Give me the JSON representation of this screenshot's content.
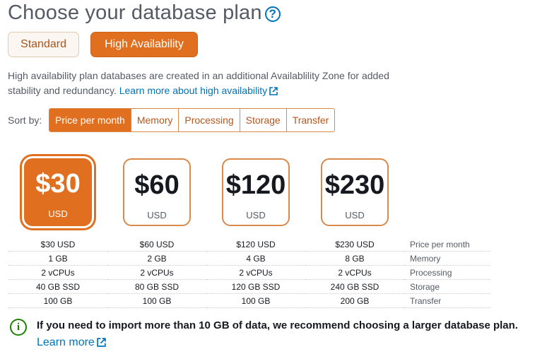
{
  "header": {
    "title": "Choose your database plan",
    "help_icon_glyph": "?"
  },
  "plan_types": {
    "standard_label": "Standard",
    "high_availability_label": "High Availability",
    "selected": "High Availability"
  },
  "description": {
    "text": "High availability plan databases are created in an additional Availablility Zone for added stability and redundancy.",
    "link_text": "Learn more about high availability"
  },
  "sort": {
    "label": "Sort by:",
    "options": [
      "Price per month",
      "Memory",
      "Processing",
      "Storage",
      "Transfer"
    ],
    "active": "Price per month"
  },
  "plans": [
    {
      "price": "$30",
      "currency": "USD",
      "selected": true,
      "price_per_month": "$30 USD",
      "memory": "1 GB",
      "processing": "2 vCPUs",
      "storage": "40 GB SSD",
      "transfer": "100 GB"
    },
    {
      "price": "$60",
      "currency": "USD",
      "selected": false,
      "price_per_month": "$60 USD",
      "memory": "2 GB",
      "processing": "2 vCPUs",
      "storage": "80 GB SSD",
      "transfer": "100 GB"
    },
    {
      "price": "$120",
      "currency": "USD",
      "selected": false,
      "price_per_month": "$120 USD",
      "memory": "4 GB",
      "processing": "2 vCPUs",
      "storage": "120 GB SSD",
      "transfer": "100 GB"
    },
    {
      "price": "$230",
      "currency": "USD",
      "selected": false,
      "price_per_month": "$230 USD",
      "memory": "8 GB",
      "processing": "2 vCPUs",
      "storage": "240 GB SSD",
      "transfer": "200 GB"
    }
  ],
  "row_labels": [
    "Price per month",
    "Memory",
    "Processing",
    "Storage",
    "Transfer"
  ],
  "notice": {
    "icon": "info-icon",
    "text": "If you need to import more than 10 GB of data, we recommend choosing a larger database plan.",
    "link_text": "Learn more"
  },
  "colors": {
    "accent": "#e07020",
    "link": "#0073bb",
    "success": "#1d8102"
  }
}
